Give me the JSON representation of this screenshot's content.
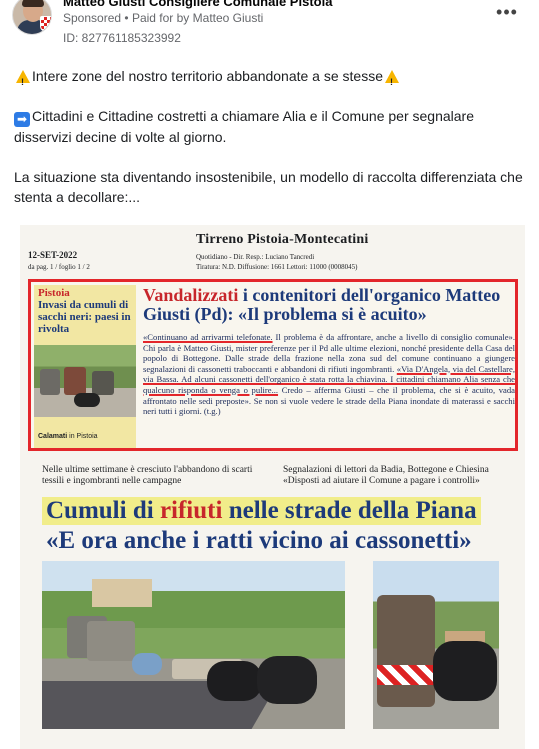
{
  "post": {
    "page_name": "Matteo Giusti Consigliere Comunale Pistoia",
    "sponsored": "Sponsored",
    "separator": "•",
    "paid_for_by": "Paid for by",
    "paid_name": "Matteo Giusti",
    "ad_id": "ID: 827761185323992",
    "more_label": "•••",
    "line1": "Intere zone del nostro territorio abbandonate a se stesse",
    "line2": "Cittadini e Cittadine costretti a chiamare Alia e il Comune per segnalare disservizi decine di volte al giorno.",
    "line3": "La situazione sta diventando insostenibile, un modello di raccolta differenziata che stenta a decollare:...",
    "icons": {
      "warning": "warning-icon",
      "arrow": "arrow-right-icon"
    }
  },
  "clipping": {
    "date": "12-SET-2022",
    "page": "da pag. 1 /   foglio 1 / 2",
    "newspaper": "Tirreno Pistoia-Montecatini",
    "meta1": "Quotidiano   - Dir. Resp.: Luciano Tancredi",
    "meta2": "Tiratura: N.D. Diffusione: 1661 Lettori: 11000 (0008045)",
    "city": "Pistoia",
    "kicker": "Invasi da cumuli di sacchi neri: paesi in rivolta",
    "credit_bold": "Calamati",
    "credit_rest": " in Pistoia",
    "headline_red": "Vandalizzati",
    "headline_rest": " i contenitori dell'organico Matteo Giusti (Pd): «Il problema si è acuito»",
    "body": {
      "part1": "«Continuano ad arrivarmi telefonate.",
      "part2": " Il problema è da affrontare, anche a livello di consiglio comunale». Chi parla è Matteo Giusti, mister preferenze per il Pd alle ultime elezioni, nonché presidente della Casa del popolo di Bottegone. Dalle strade della frazione nella zona sud del comune continuano a giungere segnalazioni di cassonetti traboccanti e abbandoni di rifiuti ingombranti. ",
      "part3": "«Via D'Angela, via del Castellare, via Bassa. Ad alcuni cassonetti dell'organico è stata rotta la chiavina. I cittadini chiamano Alia senza che qualcuno risponda o venga o pulire...",
      "part4": " Credo – afferma Giusti – che il problema, che si è acuito, vada affrontato nelle sedi preposte». Se non si vuole vedere le strade della Piana inondate di materassi e sacchi neri tutti i giorni. (t.g.)"
    },
    "col_a": "Nelle ultime settimane è cresciuto l'abbandono di scarti tessili e ingombranti nelle campagne",
    "col_b": "Segnalazioni di lettori da Badia, Bottegone e Chiesina «Disposti ad aiutare il Comune a pagare i controlli»",
    "big1_a": "Cumuli di ",
    "big1_red": "rifiuti",
    "big1_b": " nelle strade della Piana",
    "big2": "«E ora anche i ratti vicino ai cassonetti»"
  }
}
